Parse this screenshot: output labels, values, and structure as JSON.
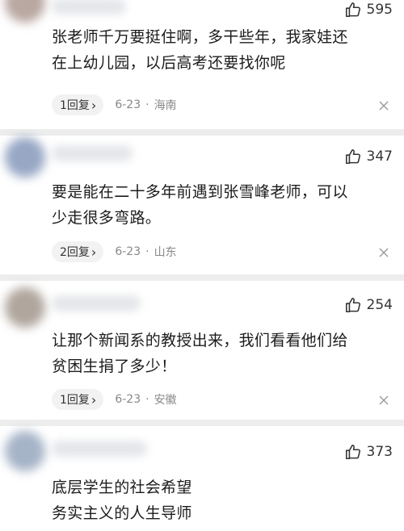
{
  "comments": [
    {
      "likes": "595",
      "text_lines": [
        "张老师千万要挺住啊，多干些年，我家娃还",
        "在上幼儿园，以后高考还要找你呢"
      ],
      "replies": "1回复",
      "date": "6-23",
      "location": "海南",
      "avatar_color": "#b9a7a1"
    },
    {
      "likes": "347",
      "text_lines": [
        "要是能在二十多年前遇到张雪峰老师，可以",
        "少走很多弯路。"
      ],
      "replies": "2回复",
      "date": "6-23",
      "location": "山东",
      "avatar_color": "#97a7c4"
    },
    {
      "likes": "254",
      "text_lines": [
        "让那个新闻系的教授出来，我们看看他们给",
        "贫困生捐了多少！"
      ],
      "replies": "1回复",
      "date": "6-23",
      "location": "安徽",
      "avatar_color": "#b0a69e"
    },
    {
      "likes": "373",
      "text_lines": [
        "底层学生的社会希望",
        "务实主义的人生导师"
      ],
      "avatar_color": "#a6b4c8"
    }
  ],
  "icons": {
    "like": "thumbs-up-icon",
    "close": "close-icon",
    "chevron": "chevron-right-icon"
  },
  "separator": "·",
  "chevron_glyph": "›"
}
